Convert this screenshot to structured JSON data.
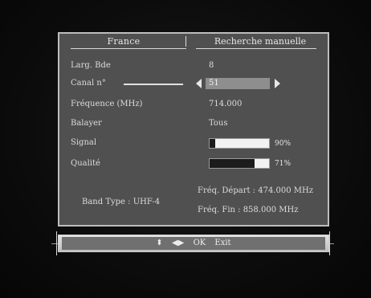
{
  "header": {
    "country": "France",
    "title": "Recherche manuelle"
  },
  "rows": {
    "bandwidth": {
      "label": "Larg. Bde",
      "value": "8"
    },
    "channel": {
      "label": "Canal n°",
      "value": "51"
    },
    "frequency": {
      "label": "Fréquence (MHz)",
      "value": "714.000"
    },
    "scan": {
      "label": "Balayer",
      "value": "Tous"
    },
    "signal": {
      "label": "Signal",
      "percent_text": "90%",
      "level": 0.9
    },
    "quality": {
      "label": "Qualité",
      "percent_text": "71%",
      "level": 0.71
    }
  },
  "band": {
    "type_text": "Band Type   : UHF-4",
    "freq_start": "Fréq. Départ : 474.000 MHz",
    "freq_end": "Fréq. Fin     : 858.000 MHz"
  },
  "footer": {
    "nav_updown": "⬍",
    "nav_leftright": "◀▶",
    "ok_label": "OK",
    "exit_label": "Exit"
  },
  "colors": {
    "panel_bg": "#505050",
    "bar_fill": "#f2f2f2",
    "channel_highlight": "#8e8e8e"
  }
}
